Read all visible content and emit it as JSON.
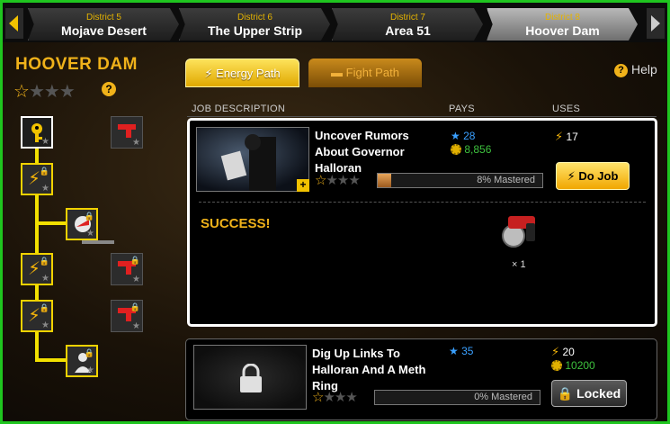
{
  "districts": [
    {
      "number": "District 5",
      "name": "Mojave Desert",
      "active": false
    },
    {
      "number": "District 6",
      "name": "The Upper Strip",
      "active": false
    },
    {
      "number": "District 7",
      "name": "Area 51",
      "active": false
    },
    {
      "number": "District 8",
      "name": "Hoover Dam",
      "active": true
    }
  ],
  "district_title": "HOOVER DAM",
  "district_stars": {
    "earned": 1,
    "total": 4
  },
  "path_tabs": {
    "energy": "Energy Path",
    "fight": "Fight Path"
  },
  "help_label": "Help",
  "columns": {
    "description": "JOB DESCRIPTION",
    "pays": "PAYS",
    "uses": "USES"
  },
  "jobs": [
    {
      "name_lines": [
        "Uncover Rumors",
        "About Governor",
        "Halloran"
      ],
      "mastery_label": "8% Mastered",
      "mastery_percent": 8,
      "pays_xp": "28",
      "pays_cash": "8,856",
      "uses_energy": "17",
      "button": "Do Job",
      "result": "SUCCESS!",
      "reward_count": "× 1"
    },
    {
      "name_lines": [
        "Dig Up Links To",
        "Halloran And A Meth",
        "Ring"
      ],
      "mastery_label": "0% Mastered",
      "mastery_percent": 0,
      "pays_xp": "35",
      "uses_energy": "20",
      "uses_cash": "10200",
      "button": "Locked"
    }
  ],
  "colors": {
    "accent": "#f0b21a",
    "frame": "#1fc51f",
    "xp": "#3aa0ff",
    "cash": "#3ec23e"
  }
}
